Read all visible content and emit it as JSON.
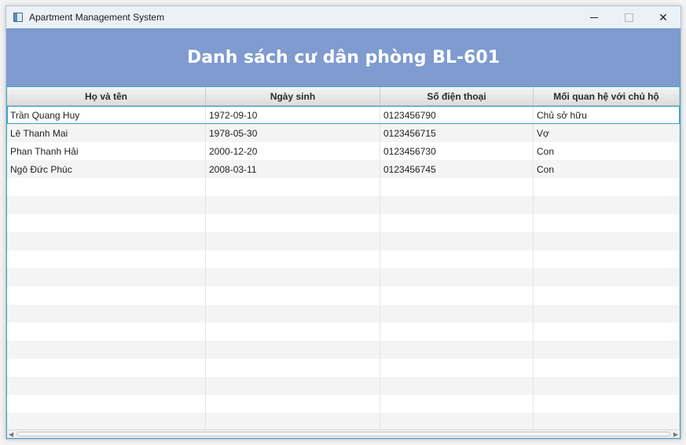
{
  "window": {
    "title": "Apartment Management System"
  },
  "controls": {
    "minimize": "—",
    "maximize": "",
    "close": "✕"
  },
  "banner": {
    "heading": "Danh sách cư dân phòng BL-601",
    "color": "#7f9bcf"
  },
  "table": {
    "headers": [
      "Họ và tên",
      "Ngày sinh",
      "Số điện thoại",
      "Mối quan hệ với chủ hộ"
    ],
    "rows": [
      [
        "Trần Quang Huy",
        "1972-09-10",
        "0123456790",
        "Chủ sở hữu"
      ],
      [
        "Lê Thanh Mai",
        "1978-05-30",
        "0123456715",
        "Vợ"
      ],
      [
        "Phan Thanh Hải",
        "2000-12-20",
        "0123456730",
        "Con"
      ],
      [
        "Ngô Đức Phúc",
        "2008-03-11",
        "0123456745",
        "Con"
      ]
    ],
    "selected_row": 0,
    "accent": "#44a6d0"
  }
}
